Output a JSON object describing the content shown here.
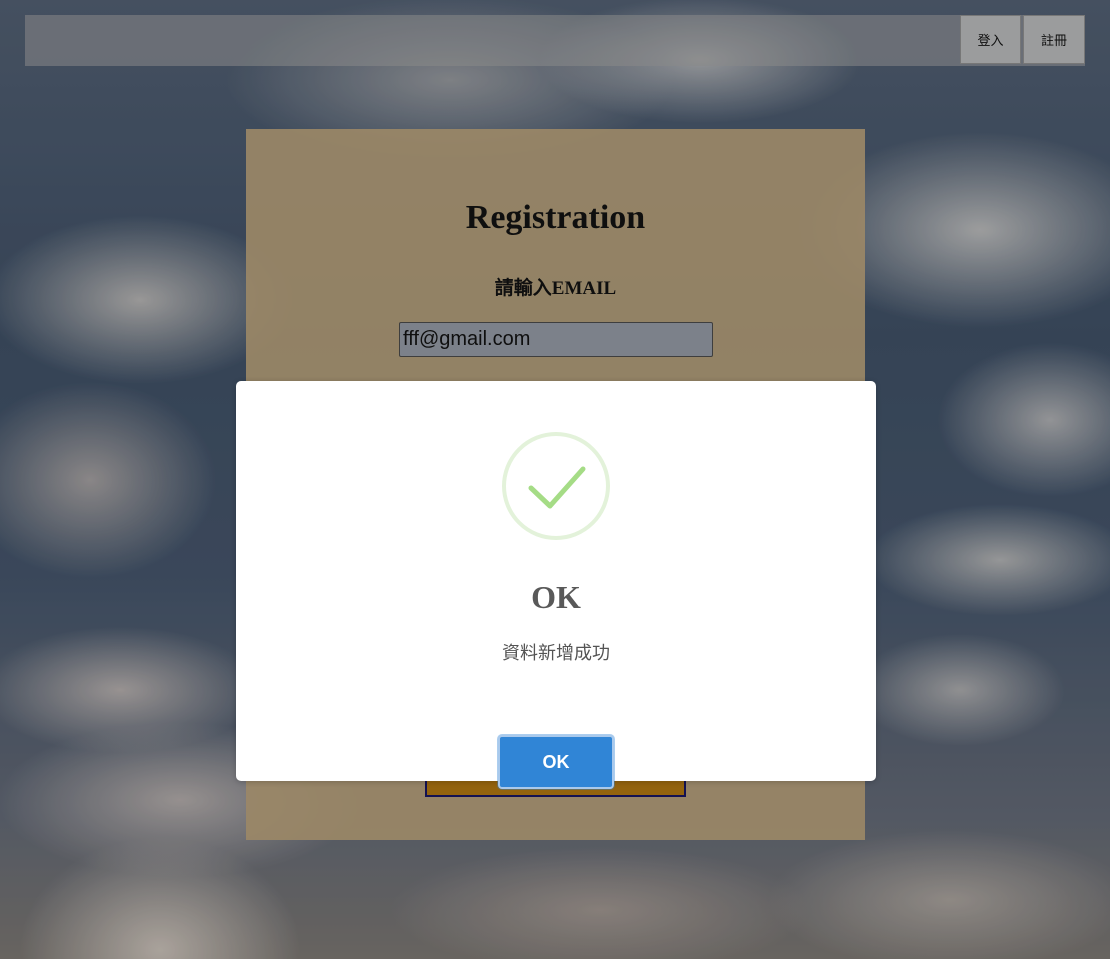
{
  "navbar": {
    "login_label": "登入",
    "register_label": "註冊"
  },
  "registration": {
    "title": "Registration",
    "email_label": "請輸入EMAIL",
    "email_value": "fff@gmail.com"
  },
  "modal": {
    "icon": "success-check-icon",
    "title": "OK",
    "message": "資料新增成功",
    "confirm_label": "OK",
    "colors": {
      "confirm_button": "#3085d6",
      "success_check": "#a5dc86"
    }
  }
}
